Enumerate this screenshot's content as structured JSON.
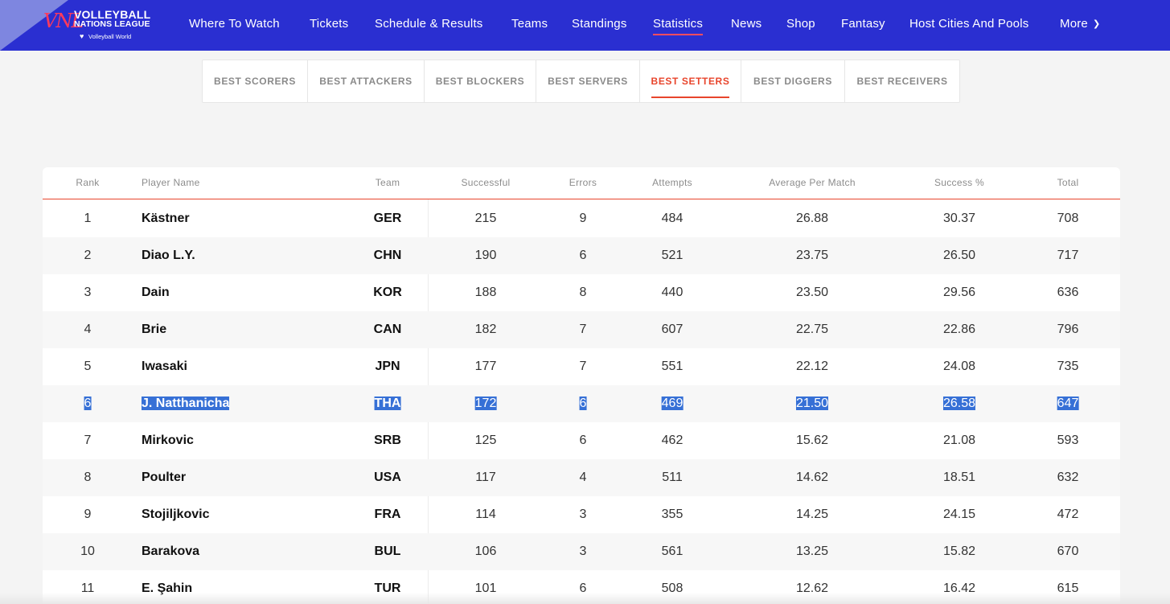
{
  "brand": {
    "line1": "VOLLEYBALL",
    "line2": "NATIONS LEAGUE",
    "line3": "Volleyball World",
    "mark": "VNL"
  },
  "nav": [
    {
      "label": "Where To Watch"
    },
    {
      "label": "Tickets"
    },
    {
      "label": "Schedule & Results"
    },
    {
      "label": "Teams"
    },
    {
      "label": "Standings"
    },
    {
      "label": "Statistics",
      "active": true
    },
    {
      "label": "News"
    },
    {
      "label": "Shop"
    },
    {
      "label": "Fantasy"
    },
    {
      "label": "Host Cities And Pools"
    },
    {
      "label": "More"
    }
  ],
  "tabs": [
    {
      "label": "BEST SCORERS"
    },
    {
      "label": "BEST ATTACKERS"
    },
    {
      "label": "BEST BLOCKERS"
    },
    {
      "label": "BEST SERVERS"
    },
    {
      "label": "BEST SETTERS",
      "active": true
    },
    {
      "label": "BEST DIGGERS"
    },
    {
      "label": "BEST RECEIVERS"
    }
  ],
  "table": {
    "headers": {
      "rank": "Rank",
      "player": "Player Name",
      "team": "Team",
      "successful": "Successful",
      "errors": "Errors",
      "attempts": "Attempts",
      "avg": "Average Per Match",
      "success_pct": "Success %",
      "total": "Total"
    },
    "rows": [
      {
        "rank": "1",
        "player": "Kästner",
        "team": "GER",
        "successful": "215",
        "errors": "9",
        "attempts": "484",
        "avg": "26.88",
        "success_pct": "30.37",
        "total": "708"
      },
      {
        "rank": "2",
        "player": "Diao L.Y.",
        "team": "CHN",
        "successful": "190",
        "errors": "6",
        "attempts": "521",
        "avg": "23.75",
        "success_pct": "26.50",
        "total": "717"
      },
      {
        "rank": "3",
        "player": "Dain",
        "team": "KOR",
        "successful": "188",
        "errors": "8",
        "attempts": "440",
        "avg": "23.50",
        "success_pct": "29.56",
        "total": "636"
      },
      {
        "rank": "4",
        "player": "Brie",
        "team": "CAN",
        "successful": "182",
        "errors": "7",
        "attempts": "607",
        "avg": "22.75",
        "success_pct": "22.86",
        "total": "796"
      },
      {
        "rank": "5",
        "player": "Iwasaki",
        "team": "JPN",
        "successful": "177",
        "errors": "7",
        "attempts": "551",
        "avg": "22.12",
        "success_pct": "24.08",
        "total": "735"
      },
      {
        "rank": "6",
        "player": "J. Natthanicha",
        "team": "THA",
        "successful": "172",
        "errors": "6",
        "attempts": "469",
        "avg": "21.50",
        "success_pct": "26.58",
        "total": "647",
        "selected": true
      },
      {
        "rank": "7",
        "player": "Mirkovic",
        "team": "SRB",
        "successful": "125",
        "errors": "6",
        "attempts": "462",
        "avg": "15.62",
        "success_pct": "21.08",
        "total": "593"
      },
      {
        "rank": "8",
        "player": "Poulter",
        "team": "USA",
        "successful": "117",
        "errors": "4",
        "attempts": "511",
        "avg": "14.62",
        "success_pct": "18.51",
        "total": "632"
      },
      {
        "rank": "9",
        "player": "Stojiljkovic",
        "team": "FRA",
        "successful": "114",
        "errors": "3",
        "attempts": "355",
        "avg": "14.25",
        "success_pct": "24.15",
        "total": "472"
      },
      {
        "rank": "10",
        "player": "Barakova",
        "team": "BUL",
        "successful": "106",
        "errors": "3",
        "attempts": "561",
        "avg": "13.25",
        "success_pct": "15.82",
        "total": "670"
      },
      {
        "rank": "11",
        "player": "E. Şahin",
        "team": "TUR",
        "successful": "101",
        "errors": "6",
        "attempts": "508",
        "avg": "12.62",
        "success_pct": "16.42",
        "total": "615"
      }
    ]
  },
  "colors": {
    "header_bg": "#2a2fd1",
    "accent": "#e8452c",
    "selection": "#3670d6"
  }
}
